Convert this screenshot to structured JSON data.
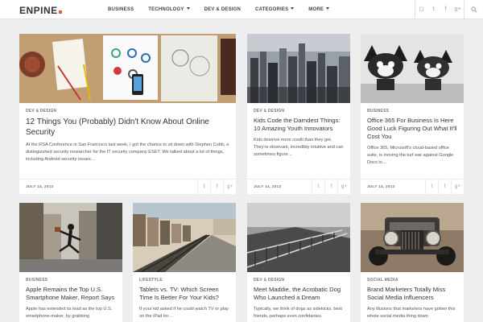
{
  "brand": {
    "name": "ENPINE",
    "accent": "#e85c2c"
  },
  "nav": [
    {
      "label": "BUSINESS",
      "dropdown": false
    },
    {
      "label": "TECHNOLOGY",
      "dropdown": true
    },
    {
      "label": "DEV & DESIGN",
      "dropdown": false
    },
    {
      "label": "CATEGORIES",
      "dropdown": true
    },
    {
      "label": "MORE",
      "dropdown": true
    }
  ],
  "social": {
    "instagram": "◻",
    "twitter": "t",
    "facebook": "f",
    "google": "g+"
  },
  "share": {
    "twitter": "t",
    "facebook": "f",
    "google": "g+"
  },
  "cards": [
    {
      "category": "DEV & DESIGN",
      "title": "12 Things You (Probably) Didn't Know About Online Security",
      "excerpt": "At the RSA Conference in San Francisco last week, I got the chance to sit down with Stephen Cobb, a distinguished security researcher for the IT security company ESET. We talked about a lot of things, including Android security issues…",
      "date": "JULY 14, 2013"
    },
    {
      "category": "DEV & DESIGN",
      "title": "Kids Code the Darndest Things: 10 Amazing Youth Innovators",
      "excerpt": "Kids deserve more credit than they get. They're obsevant, incredibly intuitive and can sometimes figure…",
      "date": "JULY 14, 2013"
    },
    {
      "category": "BUSINESS",
      "title": "Office 365 For Business Is Here Good Luck Figuring Out What It'll Cost You",
      "excerpt": "Office 365, Microsoft's cloud-based office suite, is moving the turf war against Google Docs to…",
      "date": "JULY 14, 2013"
    },
    {
      "category": "BUSINESS",
      "title": "Apple Remains the Top U.S. Smartphone Maker, Report Says",
      "excerpt": "Apple has extended its lead as the top U.S. smartphone-maker, by grabbing",
      "date": ""
    },
    {
      "category": "LIFESTYLE",
      "title": "Tablets vs. TV: Which Screen Time Is Better For Your Kids?",
      "excerpt": "If your kid asked if he could watch TV or play on the iPad for…",
      "date": ""
    },
    {
      "category": "DEV & DESIGN",
      "title": "Meet Maddie, the Acrobatic Dog Who Launched a Dream",
      "excerpt": "Typically, we think of dogs as sidekicks, best friends, perhaps even confidantes.",
      "date": ""
    },
    {
      "category": "SOCIAL MEDIA",
      "title": "Brand Marketers Totally Miss Social Media Influencers",
      "excerpt": "Any illusions that marketers have gotten this whole social media thing down",
      "date": ""
    }
  ]
}
